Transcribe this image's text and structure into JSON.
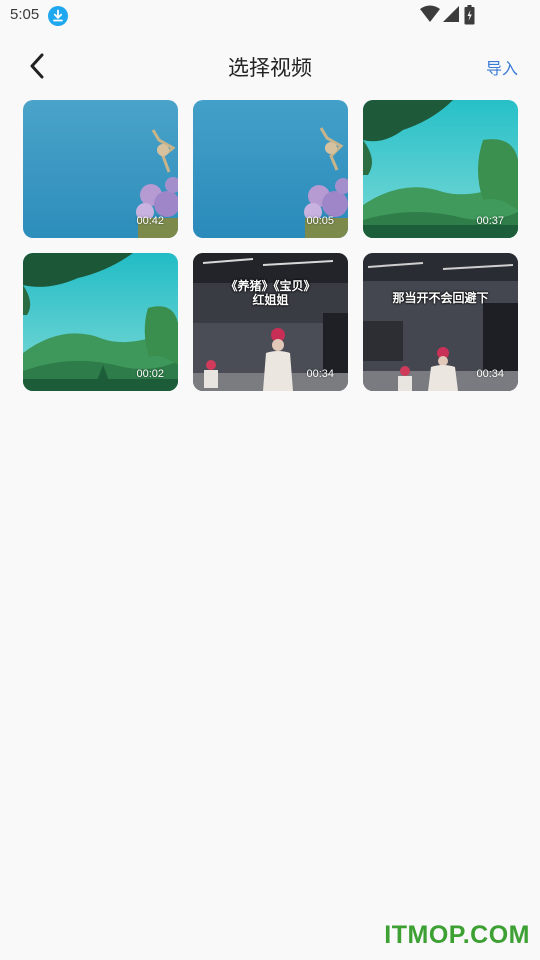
{
  "status_bar": {
    "time": "5:05",
    "icons": [
      "download-icon",
      "wifi-icon",
      "signal-icon",
      "battery-icon"
    ]
  },
  "app_bar": {
    "back_icon": "chevron-left-icon",
    "title": "选择视频",
    "import_label": "导入"
  },
  "videos": [
    {
      "duration": "00:42",
      "scene": "sky-flowers"
    },
    {
      "duration": "00:05",
      "scene": "sky-flowers"
    },
    {
      "duration": "00:37",
      "scene": "hills-trees"
    },
    {
      "duration": "00:02",
      "scene": "hills-trees"
    },
    {
      "duration": "00:34",
      "scene": "dance-studio",
      "caption": "《养猪》《宝贝》\n红姐姐"
    },
    {
      "duration": "00:34",
      "scene": "dance-studio",
      "caption": "那当开不会回避下"
    }
  ],
  "watermark": "ITMOP.COM",
  "colors": {
    "accent": "#3a7bd5",
    "watermark": "#3da033",
    "background": "#f9f9fa"
  }
}
